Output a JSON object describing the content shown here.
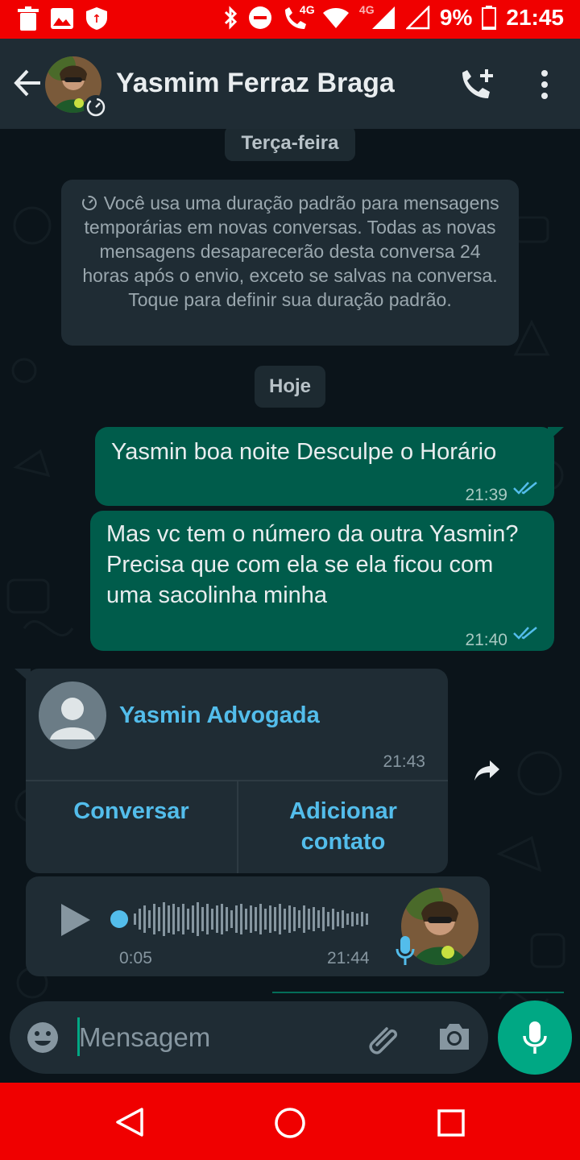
{
  "status_bar": {
    "network_label": "4G",
    "battery_percent": "9%",
    "time": "21:45"
  },
  "header": {
    "contact_name": "Yasmim Ferraz Braga"
  },
  "chat": {
    "date_chip_1": "Terça-feira",
    "system_note_icon": "timer-icon",
    "system_note": "Você usa uma duração padrão para mensagens temporárias em novas conversas. Todas as novas mensagens desaparecerão desta conversa 24 horas após o envio, exceto se salvas na conversa. Toque para definir sua duração padrão.",
    "date_chip_2": "Hoje",
    "messages": [
      {
        "text": "Yasmin boa noite Desculpe o Horário",
        "time": "21:39",
        "status": "read"
      },
      {
        "text": "Mas vc tem o número da outra Yasmin? Precisa que com ela se ela ficou com uma sacolinha minha",
        "time": "21:40",
        "status": "read"
      }
    ],
    "contact_card": {
      "name": "Yasmin Advogada",
      "time": "21:43",
      "action_1": "Conversar",
      "action_2_line1": "Adicionar",
      "action_2_line2": "contato"
    },
    "voice_note": {
      "duration": "0:05",
      "time": "21:44",
      "progress": 0
    }
  },
  "input": {
    "placeholder": "Mensagem"
  },
  "colors": {
    "status_bar": "#f00000",
    "app_bar": "#1f2c34",
    "chat_bg": "#0b141a",
    "bubble_out": "#005c4b",
    "bubble_in": "#1f2c34",
    "accent": "#00a884",
    "link": "#53bdeb"
  }
}
